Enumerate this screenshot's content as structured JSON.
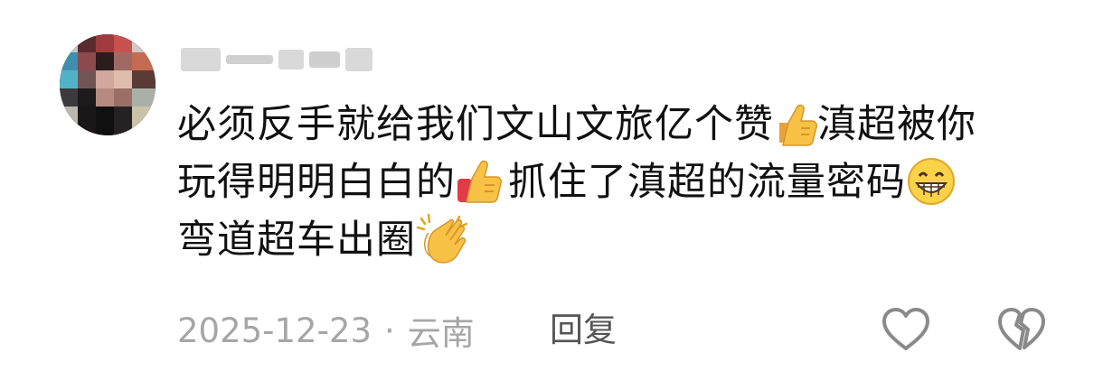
{
  "comment": {
    "avatar_icon": "pixelated-avatar",
    "username_icon": "pixelated-username",
    "text_lines": [
      [
        "必须反手就给我们文山文旅亿个赞",
        "thumbs-up-emoji",
        "滇超被你"
      ],
      [
        "玩得明明白白的",
        "thumbs-up-emoji",
        "抓住了滇超的流量密码",
        "grinning-emoji"
      ],
      [
        "弯道超车出圈",
        "clapping-hands-emoji"
      ]
    ],
    "line1_a": "必须反手就给我们文山文旅亿个赞",
    "line1_b": "滇超被你",
    "line2_a": "玩得明明白白的",
    "line2_b": "抓住了滇超的流量密码",
    "line3_a": "弯道超车出圈",
    "date": "2025-12-23",
    "separator": "·",
    "location": "云南",
    "reply_label": "回复",
    "like_icon": "heart-outline-icon",
    "dislike_icon": "broken-heart-icon"
  },
  "colors": {
    "text": "#111111",
    "meta": "#a6a6a6",
    "reply": "#555555",
    "icon": "#8a8a8a"
  }
}
